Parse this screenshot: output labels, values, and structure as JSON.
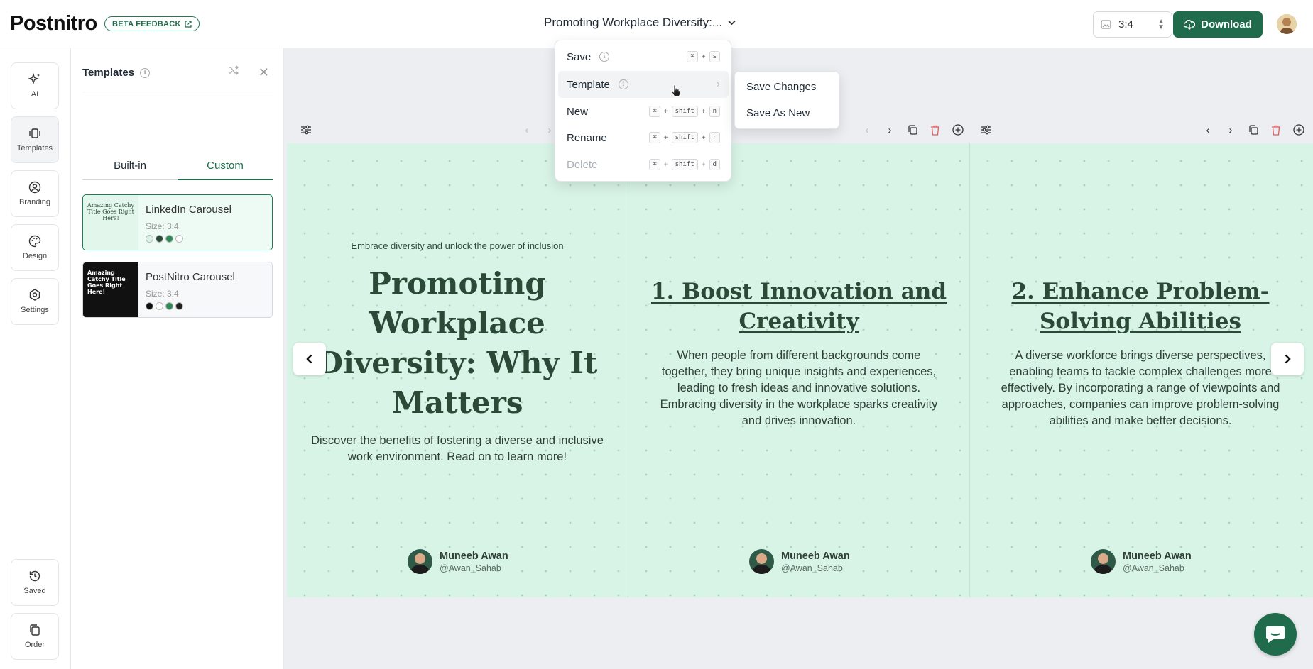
{
  "app": {
    "logo": "Postnitro",
    "beta_label": "BETA FEEDBACK"
  },
  "header": {
    "doc_title": "Promoting Workplace Diversity:...",
    "ratio": "3:4",
    "download_label": "Download"
  },
  "rail": {
    "items": [
      {
        "label": "AI",
        "icon": "sparkles-icon"
      },
      {
        "label": "Templates",
        "icon": "carousel-icon"
      },
      {
        "label": "Branding",
        "icon": "user-circle-icon"
      },
      {
        "label": "Design",
        "icon": "palette-icon"
      },
      {
        "label": "Settings",
        "icon": "gear-icon"
      },
      {
        "label": "Saved",
        "icon": "history-icon"
      },
      {
        "label": "Order",
        "icon": "copy-icon"
      }
    ]
  },
  "panel": {
    "title": "Templates",
    "tabs": [
      {
        "label": "Built-in"
      },
      {
        "label": "Custom"
      }
    ],
    "templates": [
      {
        "name": "LinkedIn Carousel",
        "size": "Size: 3:4",
        "thumb_text": "Amazing Catchy Title Goes Right Here!",
        "swatches": [
          "#d8f4e6",
          "#2a4a37",
          "#2e8b57",
          "#ffffff"
        ]
      },
      {
        "name": "PostNitro Carousel",
        "size": "Size: 3:4",
        "thumb_text": "Amazing Catchy Title Goes Right Here!",
        "swatches": [
          "#111111",
          "#ffffff",
          "#2e8b57",
          "#222222"
        ]
      }
    ]
  },
  "menu": {
    "items": [
      {
        "label": "Save",
        "keys": [
          "⌘",
          "+",
          "s"
        ]
      },
      {
        "label": "Template"
      },
      {
        "label": "New",
        "keys": [
          "⌘",
          "+",
          "shift",
          "+",
          "n"
        ]
      },
      {
        "label": "Rename",
        "keys": [
          "⌘",
          "+",
          "shift",
          "+",
          "r"
        ]
      },
      {
        "label": "Delete",
        "keys": [
          "⌘",
          "+",
          "shift",
          "+",
          "d"
        ]
      }
    ],
    "submenu": [
      {
        "label": "Save Changes"
      },
      {
        "label": "Save As New"
      }
    ]
  },
  "slides": [
    {
      "kicker": "Embrace diversity and unlock the power of inclusion",
      "title": "Promoting Workplace Diversity: Why It Matters",
      "body": "Discover the benefits of fostering a diverse and inclusive work environment. Read on to learn more!",
      "author_name": "Muneeb Awan",
      "author_handle": "@Awan_Sahab"
    },
    {
      "title": "1. Boost Innovation and Creativity",
      "body": "When people from different backgrounds come together, they bring unique insights and experiences, leading to fresh ideas and innovative solutions. Embracing diversity in the workplace sparks creativity and drives innovation.",
      "author_name": "Muneeb Awan",
      "author_handle": "@Awan_Sahab"
    },
    {
      "title": "2. Enhance Problem-Solving Abilities",
      "body": "A diverse workforce brings diverse perspectives, enabling teams to tackle complex challenges more effectively. By incorporating a range of viewpoints and approaches, companies can improve problem-solving abilities and make better decisions.",
      "author_name": "Muneeb Awan",
      "author_handle": "@Awan_Sahab"
    }
  ],
  "colors": {
    "brand": "#1f6b4b",
    "slide_bg": "#d8f4e6",
    "title": "#2a4a37",
    "delete": "#e06060"
  }
}
